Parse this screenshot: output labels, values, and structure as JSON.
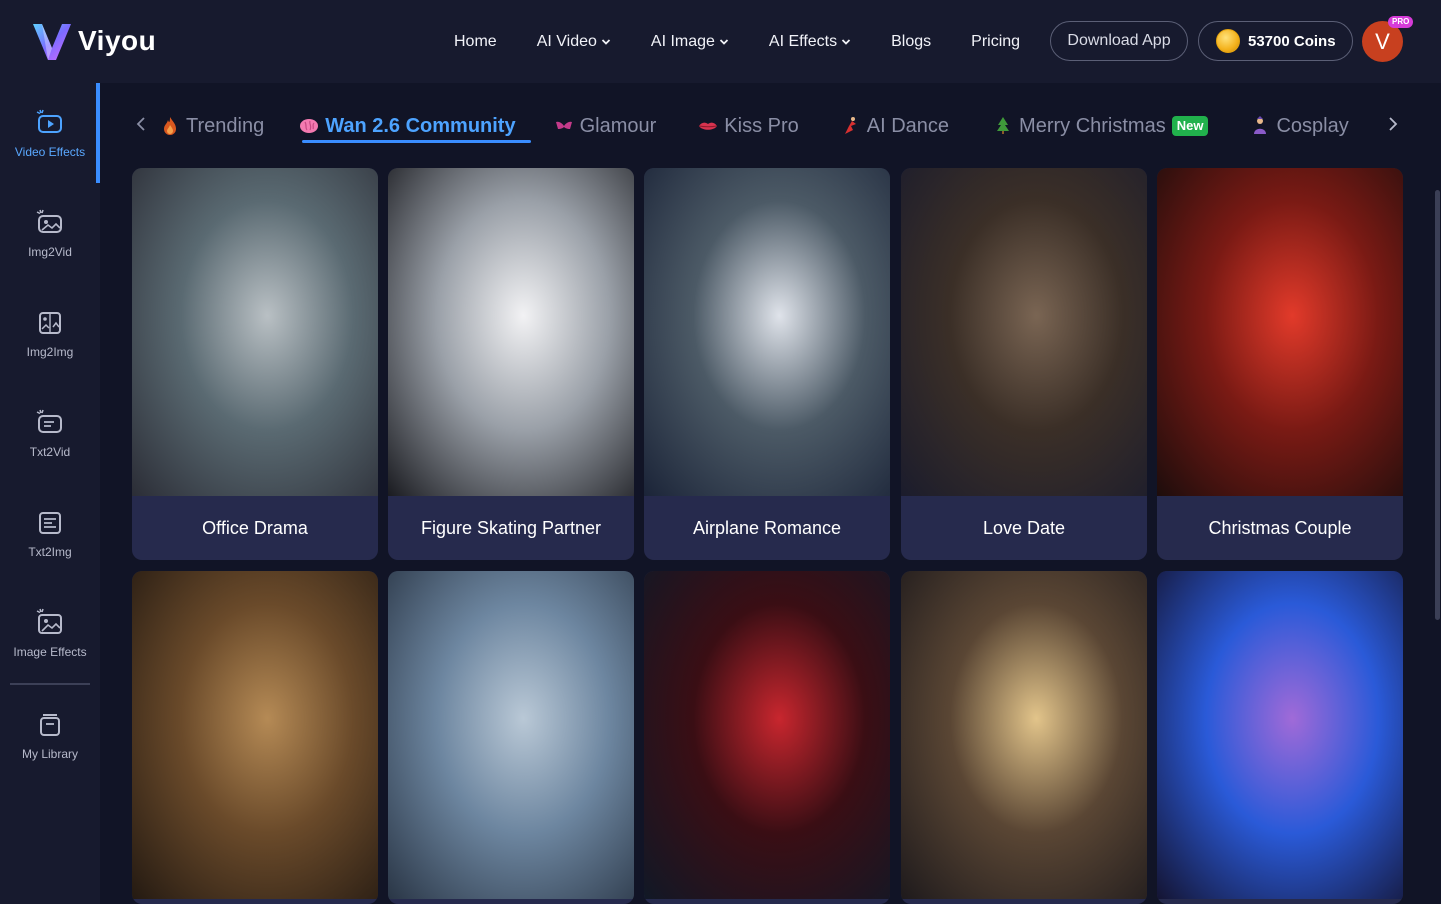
{
  "brand": {
    "name": "Viyou"
  },
  "nav": {
    "items": [
      {
        "label": "Home",
        "dropdown": false
      },
      {
        "label": "AI Video",
        "dropdown": true
      },
      {
        "label": "AI Image",
        "dropdown": true
      },
      {
        "label": "AI Effects",
        "dropdown": true
      },
      {
        "label": "Blogs",
        "dropdown": false
      },
      {
        "label": "Pricing",
        "dropdown": false
      }
    ],
    "download_label": "Download App",
    "coins_label": "53700 Coins",
    "avatar_letter": "V",
    "pro_badge": "PRO"
  },
  "sidebar": {
    "items": [
      {
        "label": "Video Effects",
        "icon": "video-effects-icon",
        "active": true
      },
      {
        "label": "Img2Vid",
        "icon": "img2vid-icon",
        "active": false
      },
      {
        "label": "Img2Img",
        "icon": "img2img-icon",
        "active": false
      },
      {
        "label": "Txt2Vid",
        "icon": "txt2vid-icon",
        "active": false
      },
      {
        "label": "Txt2Img",
        "icon": "txt2img-icon",
        "active": false
      },
      {
        "label": "Image Effects",
        "icon": "image-effects-icon",
        "active": false
      },
      {
        "label": "My Library",
        "icon": "library-icon",
        "active": false
      }
    ]
  },
  "categories": {
    "tabs": [
      {
        "label": "Trending",
        "icon": "flame-icon",
        "active": false,
        "badge": ""
      },
      {
        "label": "Wan 2.6 Community",
        "icon": "brain-icon",
        "active": true,
        "badge": ""
      },
      {
        "label": "Glamour",
        "icon": "lingerie-icon",
        "active": false,
        "badge": ""
      },
      {
        "label": "Kiss Pro",
        "icon": "lips-icon",
        "active": false,
        "badge": ""
      },
      {
        "label": "AI Dance",
        "icon": "dancer-icon",
        "active": false,
        "badge": ""
      },
      {
        "label": "Merry Christmas",
        "icon": "christmas-tree-icon",
        "active": false,
        "badge": "New"
      },
      {
        "label": "Cosplay",
        "icon": "cosplay-icon",
        "active": false,
        "badge": ""
      }
    ]
  },
  "cards": [
    {
      "title": "Office Drama",
      "palette": [
        "#b9c0c4",
        "#5a6a72",
        "#2b2d36"
      ]
    },
    {
      "title": "Figure Skating Partner",
      "palette": [
        "#f2f2f4",
        "#9aa0a8",
        "#1a1b20"
      ]
    },
    {
      "title": "Airplane Romance",
      "palette": [
        "#dfe3ea",
        "#4c5a66",
        "#1b2438"
      ]
    },
    {
      "title": "Love Date",
      "palette": [
        "#7a6553",
        "#3b2f27",
        "#1b1c2c"
      ]
    },
    {
      "title": "Christmas Couple",
      "palette": [
        "#e23a2a",
        "#7a1a14",
        "#1d0d0c"
      ]
    },
    {
      "title": "",
      "palette": [
        "#b58a55",
        "#6a4a2a",
        "#241a12"
      ]
    },
    {
      "title": "",
      "palette": [
        "#b9c8d6",
        "#6d86a0",
        "#2a3646"
      ]
    },
    {
      "title": "",
      "palette": [
        "#c8262e",
        "#3a0e14",
        "#111826"
      ]
    },
    {
      "title": "",
      "palette": [
        "#e2c48a",
        "#5a4634",
        "#1e1a1c"
      ]
    },
    {
      "title": "",
      "palette": [
        "#a06ad8",
        "#2a5ad8",
        "#141432"
      ]
    }
  ]
}
